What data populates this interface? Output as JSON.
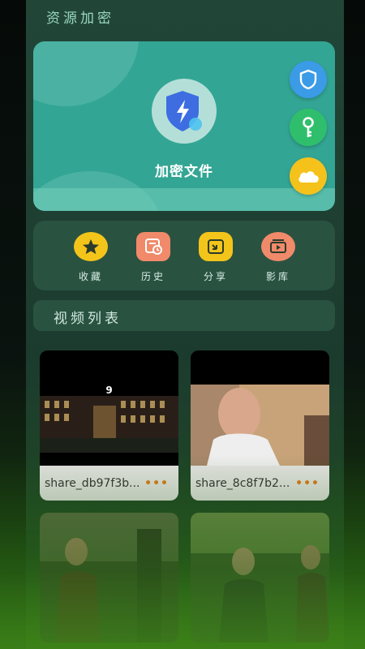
{
  "header": {
    "title": "资源加密"
  },
  "hero": {
    "caption": "加密文件"
  },
  "side_buttons": [
    {
      "icon": "shield-icon",
      "color": "#3b9be6"
    },
    {
      "icon": "key-icon",
      "color": "#2fbf6c"
    },
    {
      "icon": "cloud-icon",
      "color": "#f5c21c"
    }
  ],
  "actions": [
    {
      "label": "收藏",
      "icon": "star-icon",
      "color": "#f3c51a"
    },
    {
      "label": "历史",
      "icon": "history-icon",
      "color": "#f08a6a"
    },
    {
      "label": "分享",
      "icon": "share-icon",
      "color": "#f3c51a"
    },
    {
      "label": "影库",
      "icon": "film-library-icon",
      "color": "#f08a6a"
    }
  ],
  "section": {
    "title": "视频列表"
  },
  "videos": [
    {
      "name": "share_db97f3b...",
      "more": "•••",
      "overlay": "9"
    },
    {
      "name": "share_8c8f7b2...",
      "more": "•••"
    },
    {
      "name": ""
    },
    {
      "name": ""
    }
  ]
}
